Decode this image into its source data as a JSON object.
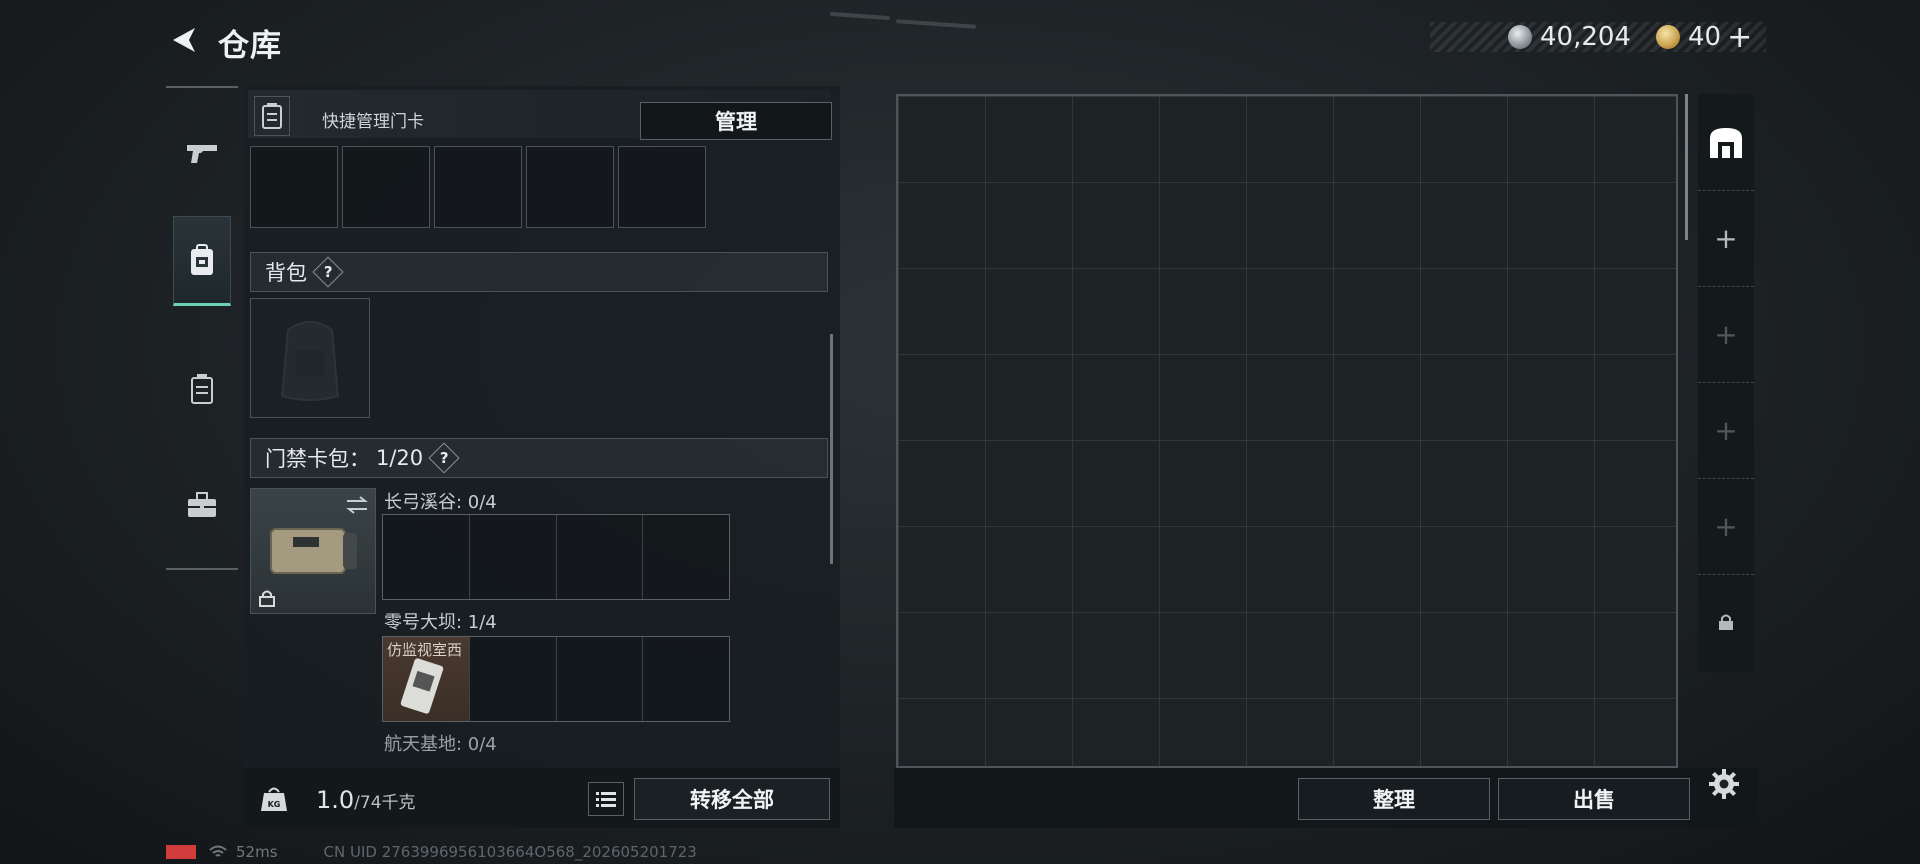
{
  "header": {
    "title": "仓库",
    "back_icon": "back-arrow-icon"
  },
  "currency": {
    "silver_value": "40,204",
    "gold_value": "40",
    "gold_plus": "+"
  },
  "side_nav": {
    "items": [
      {
        "name": "weapon",
        "icon": "pistol-icon"
      },
      {
        "name": "equipment",
        "icon": "backpack-icon",
        "active": true
      },
      {
        "name": "card-holder",
        "icon": "card-holder-icon"
      },
      {
        "name": "toolbox",
        "icon": "toolbox-icon"
      }
    ]
  },
  "left_panel": {
    "card_header_label": "快捷管理门卡",
    "manage_label": "管理",
    "backpack_section": "背包",
    "question_mark": "?",
    "keycard_section": "门禁卡包：",
    "keycard_count": "1/20",
    "sub_sections": [
      {
        "label": "长弓溪谷: 0/4"
      },
      {
        "label": "零号大坝: 1/4",
        "filled_item": "仿监视室西"
      },
      {
        "label": "航天基地: 0/4"
      }
    ],
    "weight_value": "1.0",
    "weight_max": "/74千克",
    "transfer_all_label": "转移全部"
  },
  "storage": {
    "organize_label": "整理",
    "sell_label": "出售",
    "strip": [
      "+",
      "+",
      "+",
      "+"
    ]
  },
  "status": {
    "ping": "52ms",
    "uid": "CN UID 2763996956103664O568_202605201723"
  },
  "colors": {
    "accent": "#6fd0b8",
    "battery_low": "#d23c3c"
  }
}
